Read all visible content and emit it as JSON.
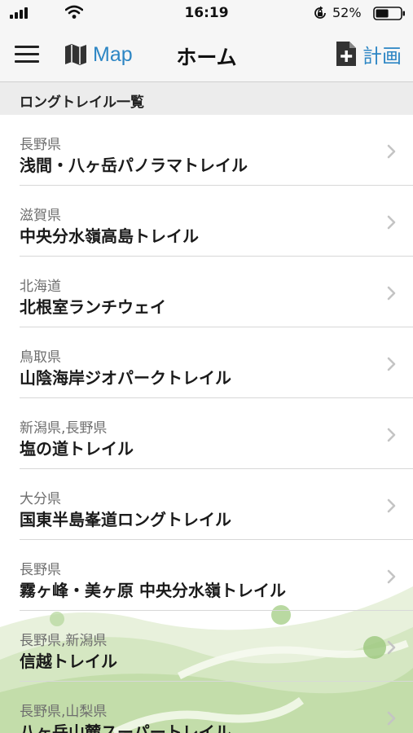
{
  "status_bar": {
    "time": "16:19",
    "battery_percent": "52%",
    "battery_level": 0.52,
    "icons": [
      "signal-icon",
      "wifi-icon",
      "orientation-lock-icon",
      "battery-icon"
    ]
  },
  "nav": {
    "map_label": "Map",
    "title": "ホーム",
    "plan_label": "計画",
    "accent_color": "#2d86c4"
  },
  "section": {
    "header": "ロングトレイル一覧"
  },
  "trails": [
    {
      "region": "長野県",
      "name": "浅間・八ヶ岳パノラマトレイル"
    },
    {
      "region": "滋賀県",
      "name": "中央分水嶺高島トレイル"
    },
    {
      "region": "北海道",
      "name": "北根室ランチウェイ"
    },
    {
      "region": "鳥取県",
      "name": "山陰海岸ジオパークトレイル"
    },
    {
      "region": "新潟県,長野県",
      "name": "塩の道トレイル"
    },
    {
      "region": "大分県",
      "name": "国東半島峯道ロングトレイル"
    },
    {
      "region": "長野県",
      "name": "霧ヶ峰・美ヶ原 中央分水嶺トレイル"
    },
    {
      "region": "長野県,新潟県",
      "name": "信越トレイル"
    },
    {
      "region": "長野県,山梨県",
      "name": "八ヶ岳山麓スーパートレイル"
    }
  ]
}
